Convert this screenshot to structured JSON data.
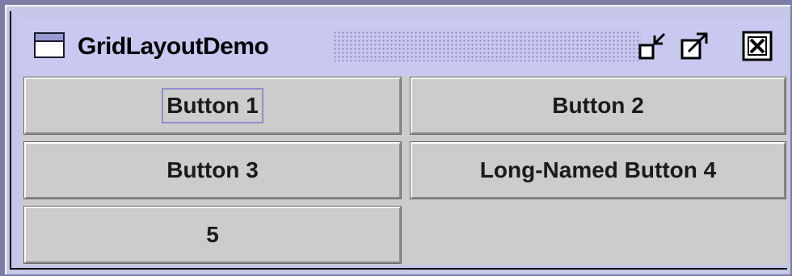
{
  "window": {
    "title": "GridLayoutDemo",
    "controls": {
      "minimize_icon": "minimize-icon",
      "maximize_icon": "maximize-icon",
      "close_icon": "close-icon"
    }
  },
  "grid": {
    "buttons": [
      {
        "label": "Button 1",
        "focused": true
      },
      {
        "label": "Button 2",
        "focused": false
      },
      {
        "label": "Button 3",
        "focused": false
      },
      {
        "label": "Long-Named Button 4",
        "focused": false
      },
      {
        "label": "5",
        "focused": false
      }
    ]
  },
  "colors": {
    "title_bar": "#c8c8f0",
    "frame": "#7c7ca6",
    "button_face": "#cccccc",
    "focus_ring": "#8f8fcf"
  }
}
